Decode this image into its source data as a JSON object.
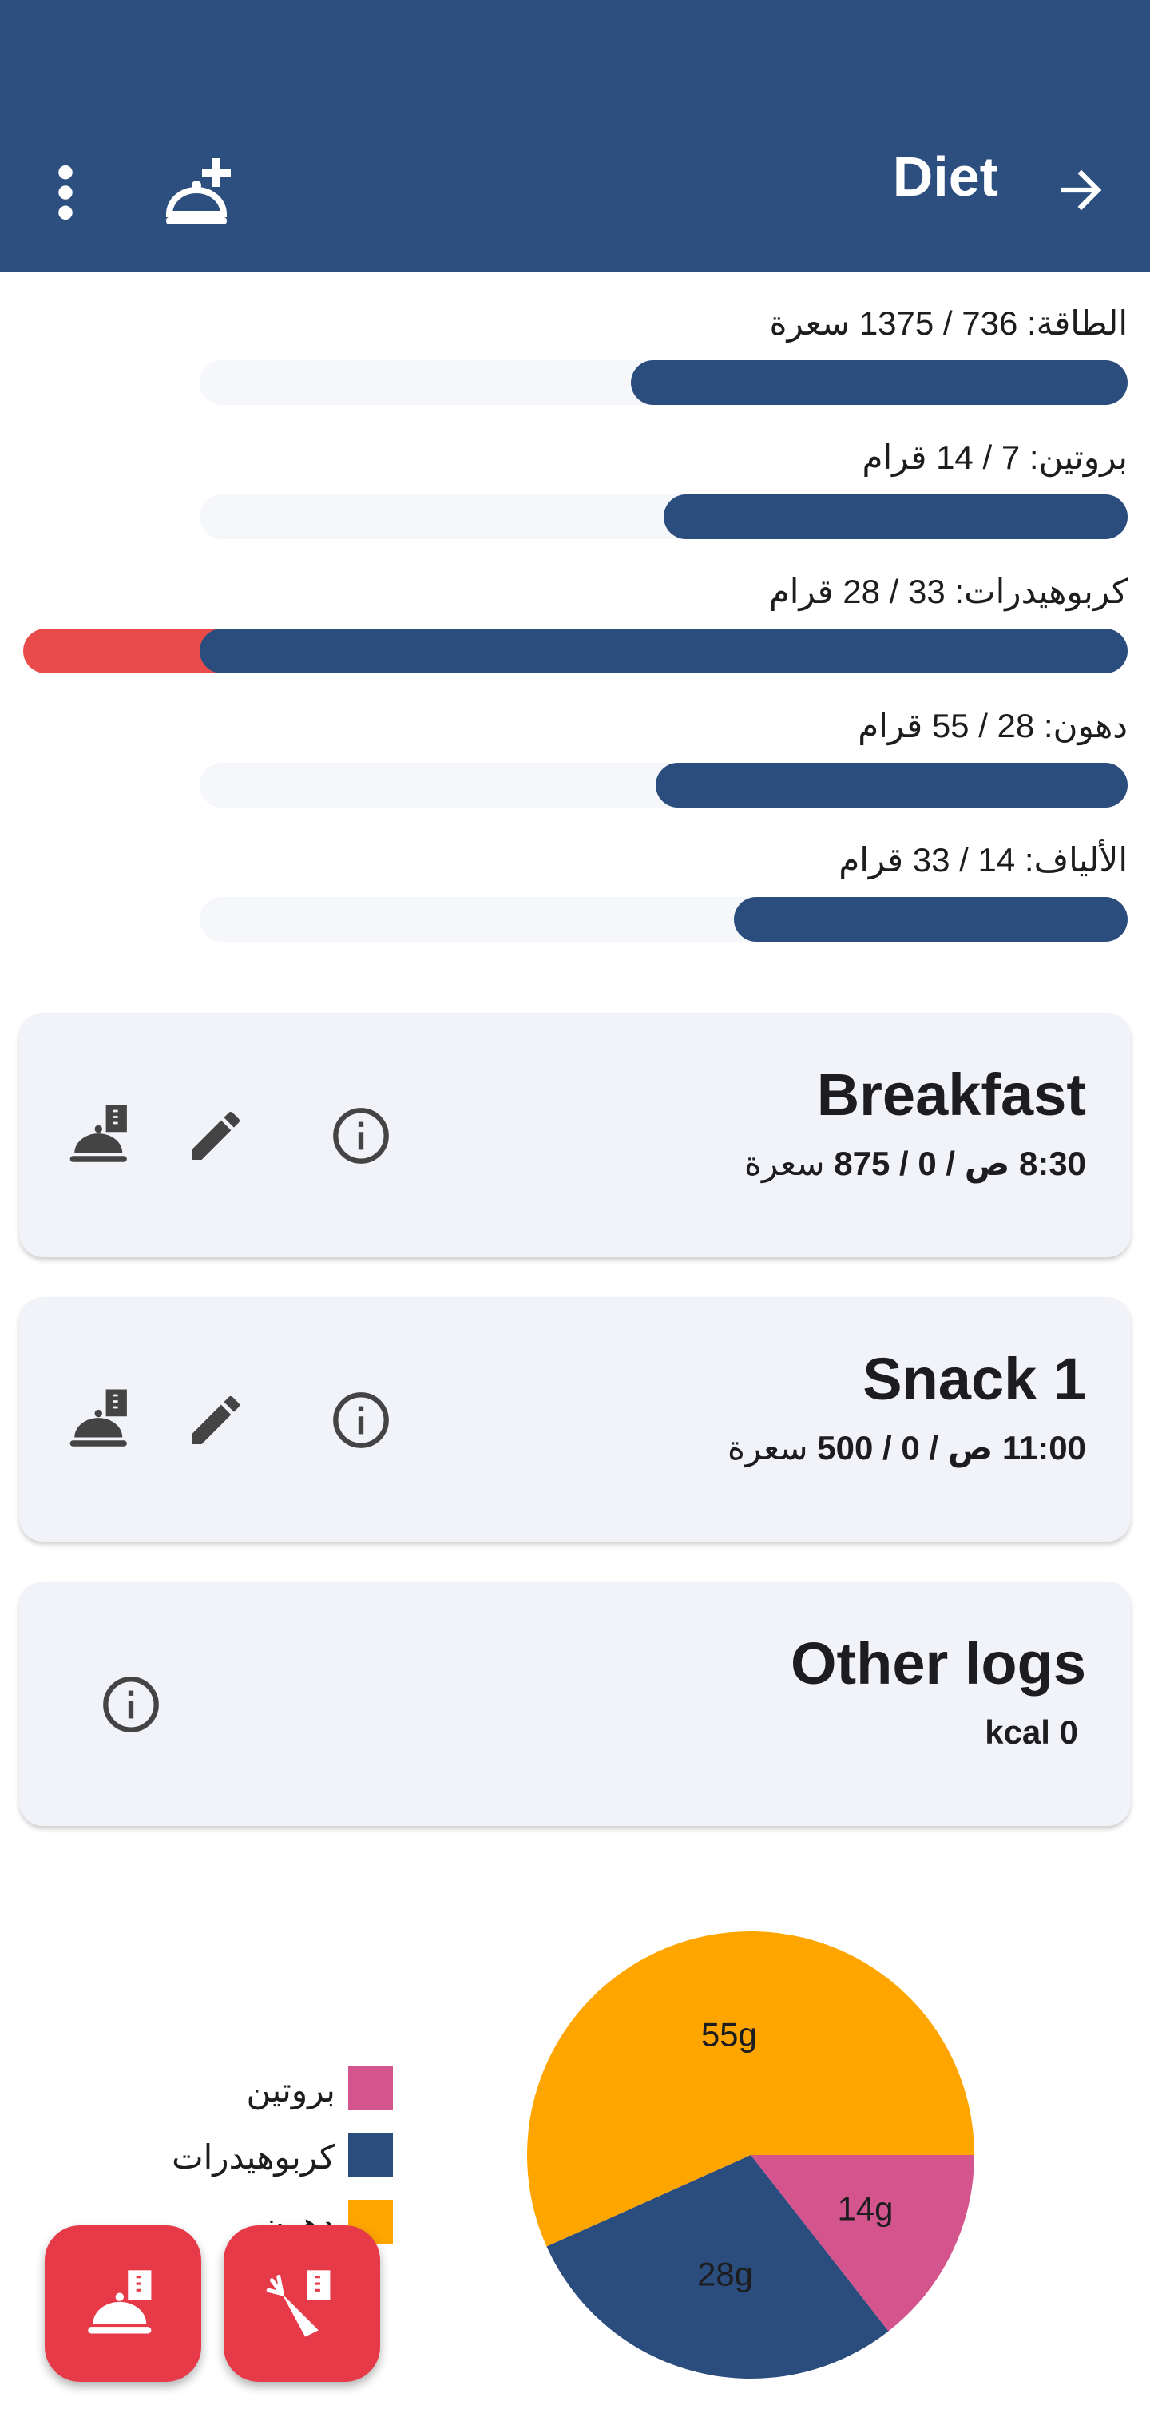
{
  "appbar": {
    "title": "Diet",
    "icons": [
      "arrow-forward-icon",
      "add-meal-icon",
      "more-vert-icon"
    ]
  },
  "nutrients": [
    {
      "label": "الطاقة: 736 / 1375 سعرة",
      "fraction": 0.535,
      "over": 0
    },
    {
      "label": "بروتين: 7 / 14 قرام",
      "fraction": 0.5,
      "over": 0
    },
    {
      "label": "كربوهيدرات: 33 / 28 قرام",
      "fraction": 1.0,
      "over": 0.19
    },
    {
      "label": "دهون: 28 / 55 قرام",
      "fraction": 0.509,
      "over": 0
    },
    {
      "label": "الألياف: 14 / 33 قرام",
      "fraction": 0.424,
      "over": 0
    }
  ],
  "meals": [
    {
      "title": "Breakfast",
      "time": "8:30 ص",
      "sep1": " / ",
      "kcal": "0 / 875",
      "unit": " سعرة"
    },
    {
      "title": "Snack 1",
      "time": "11:00 ص",
      "sep1": " / ",
      "kcal": "0 / 500",
      "unit": " سعرة"
    }
  ],
  "other_logs": {
    "title": "Other logs",
    "kcal": "kcal 0"
  },
  "colors": {
    "primary": "#2c4f80",
    "bar_fill": "#2b4d7e",
    "over": "#e94b4b",
    "protein": "#d4548e",
    "carbs": "#2b4d7e",
    "fat": "#ffa500",
    "fab": "#e63a48"
  },
  "chart_data": {
    "type": "pie",
    "categories": [
      "بروتين",
      "كربوهيدرات",
      "دهون"
    ],
    "values": [
      14,
      28,
      55
    ],
    "data_labels": [
      "14g",
      "28g",
      "55g"
    ],
    "colors": [
      "#d4548e",
      "#2b4d7e",
      "#ffa500"
    ],
    "legend": "left"
  }
}
